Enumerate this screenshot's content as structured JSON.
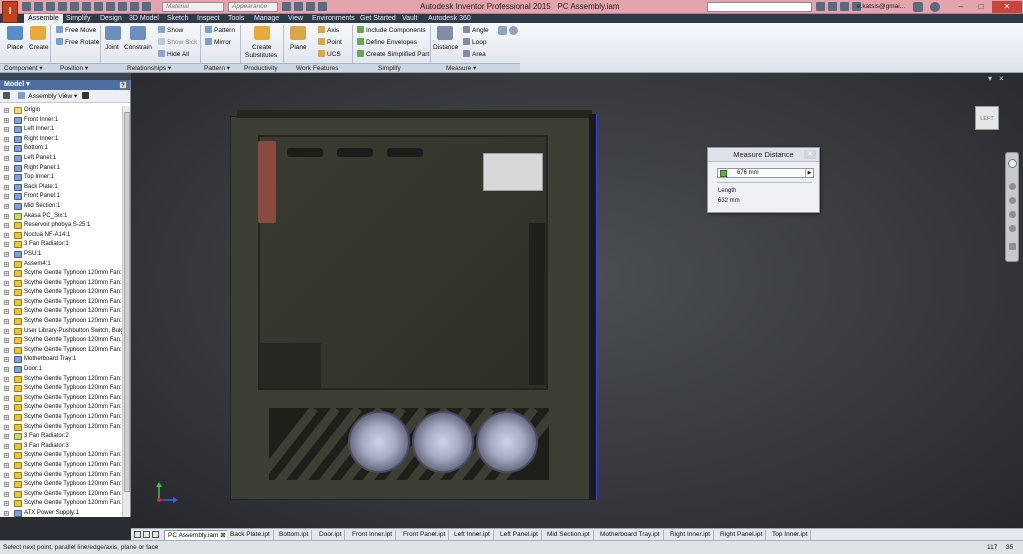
{
  "window": {
    "app_title": "Autodesk Inventor Professional 2015",
    "document_title": "PC Assembly.iam",
    "app_button": "I",
    "material_placeholder": "Material",
    "appearance_placeholder": "Appearance",
    "user": "e.katsis@gmai...",
    "minimize": "–",
    "maximize": "□",
    "close": "✕"
  },
  "menu_tabs": [
    "Assemble",
    "Simplify",
    "Design",
    "3D Model",
    "Sketch",
    "Inspect",
    "Tools",
    "Manage",
    "View",
    "Environments",
    "Get Started",
    "Vault",
    "Autodesk 360"
  ],
  "ribbon": {
    "place": "Place",
    "create": "Create",
    "free_move": "Free Move",
    "free_rotate": "Free Rotate",
    "joint": "Joint",
    "constrain": "Constrain",
    "show": "Show",
    "show_sick": "Show Sick",
    "hide_all": "Hide All",
    "pattern": "Pattern",
    "mirror": "Mirror",
    "create_substitutes": "Create",
    "substitutes": "Substitutes",
    "plane": "Plane",
    "axis": "Axis",
    "point": "Point",
    "ucs": "UCS",
    "include_components": "Include Components",
    "define_envelopes": "Define Envelopes",
    "create_simplified_part": "Create Simplified Part",
    "distance": "Distance",
    "angle": "Angle",
    "loop": "Loop",
    "area": "Area",
    "panels": [
      "Component ▾",
      "Position ▾",
      "Relationships ▾",
      "Pattern ▾",
      "Productivity",
      "Work Features",
      "Simplify",
      "Measure ▾"
    ]
  },
  "browser": {
    "title": "Model ▾",
    "help": "?",
    "view": "Assembly View",
    "items": [
      {
        "label": "Origin",
        "icon": "fold"
      },
      {
        "label": "Front Inner:1",
        "icon": "part"
      },
      {
        "label": "Left Inner:1",
        "icon": "part"
      },
      {
        "label": "Right Inner:1",
        "icon": "part"
      },
      {
        "label": "Bottom:1",
        "icon": "part"
      },
      {
        "label": "Left Panel:1",
        "icon": "part"
      },
      {
        "label": "Right Panel:1",
        "icon": "part"
      },
      {
        "label": "Top Inner:1",
        "icon": "part"
      },
      {
        "label": "Back Plate:1",
        "icon": "part"
      },
      {
        "label": "Front Panel:1",
        "icon": "part"
      },
      {
        "label": "Mid Section:1",
        "icon": "part"
      },
      {
        "label": "Akasa PC_Six:1",
        "icon": "pat"
      },
      {
        "label": "Reservoir phobya S-25:1",
        "icon": "asm"
      },
      {
        "label": "Noctua NF-A14:1",
        "icon": "asm"
      },
      {
        "label": "3 Fan Radiator:1",
        "icon": "asm"
      },
      {
        "label": "PSU:1",
        "icon": "part"
      },
      {
        "label": "Assem4:1",
        "icon": "asm"
      },
      {
        "label": "Scythe Gentle Typhoon 120mm Fan:1",
        "icon": "asm"
      },
      {
        "label": "Scythe Gentle Typhoon 120mm Fan:2",
        "icon": "asm"
      },
      {
        "label": "Scythe Gentle Typhoon 120mm Fan:3",
        "icon": "asm"
      },
      {
        "label": "Scythe Gentle Typhoon 120mm Fan:4",
        "icon": "asm"
      },
      {
        "label": "Scythe Gentle Typhoon 120mm Fan:5",
        "icon": "asm"
      },
      {
        "label": "Scythe Gentle Typhoon 120mm Fan:6",
        "icon": "asm"
      },
      {
        "label": "User Library-Pushbutton Switch, Bulg",
        "icon": "asm"
      },
      {
        "label": "Scythe Gentle Typhoon 120mm Fan:7",
        "icon": "asm"
      },
      {
        "label": "Scythe Gentle Typhoon 120mm Fan:8",
        "icon": "asm"
      },
      {
        "label": "Motherboard Tray:1",
        "icon": "part"
      },
      {
        "label": "Door:1",
        "icon": "part"
      },
      {
        "label": "Scythe Gentle Typhoon 120mm Fan:9",
        "icon": "asm"
      },
      {
        "label": "Scythe Gentle Typhoon 120mm Fan:1",
        "icon": "asm"
      },
      {
        "label": "Scythe Gentle Typhoon 120mm Fan:1",
        "icon": "asm"
      },
      {
        "label": "Scythe Gentle Typhoon 120mm Fan:1",
        "icon": "asm"
      },
      {
        "label": "Scythe Gentle Typhoon 120mm Fan:1",
        "icon": "asm"
      },
      {
        "label": "Scythe Gentle Typhoon 120mm Fan:1",
        "icon": "asm"
      },
      {
        "label": "3 Fan Radiator:2",
        "icon": "pat"
      },
      {
        "label": "3 Fan Radiator:3",
        "icon": "asm"
      },
      {
        "label": "Scythe Gentle Typhoon 120mm Fan:1",
        "icon": "asm"
      },
      {
        "label": "Scythe Gentle Typhoon 120mm Fan:1",
        "icon": "asm"
      },
      {
        "label": "Scythe Gentle Typhoon 120mm Fan:1",
        "icon": "asm"
      },
      {
        "label": "Scythe Gentle Typhoon 120mm Fan:1",
        "icon": "asm"
      },
      {
        "label": "Scythe Gentle Typhoon 120mm Fan:1",
        "icon": "asm"
      },
      {
        "label": "Scythe Gentle Typhoon 120mm Fan:2",
        "icon": "asm"
      },
      {
        "label": "ATX Power Supply:1",
        "icon": "part"
      }
    ]
  },
  "viewcube": "LEFT",
  "measure": {
    "title": "Measure Distance",
    "close": "✕",
    "value": "676 mm",
    "length_label": "Length",
    "length_value": "632 mm"
  },
  "doc_tabs": [
    "PC Assembly.iam",
    "Back Plate.ipt",
    "Bottom.ipt",
    "Door.ipt",
    "Front Inner.ipt",
    "Front Panel.ipt",
    "Left Inner.ipt",
    "Left Panel.ipt",
    "Mid Section.ipt",
    "Motherboard Tray.ipt",
    "Right Inner.ipt",
    "Right Panel.ipt",
    "Top Inner.ipt"
  ],
  "status": {
    "text": "Select next point, parallel line/edge/axis, plane or face",
    "n1": "117",
    "n2": "35"
  },
  "colors": {
    "titlebar": "#e3a4ad",
    "tabs_bg": "#2f3a4a",
    "viewport": "#3c3e41"
  }
}
